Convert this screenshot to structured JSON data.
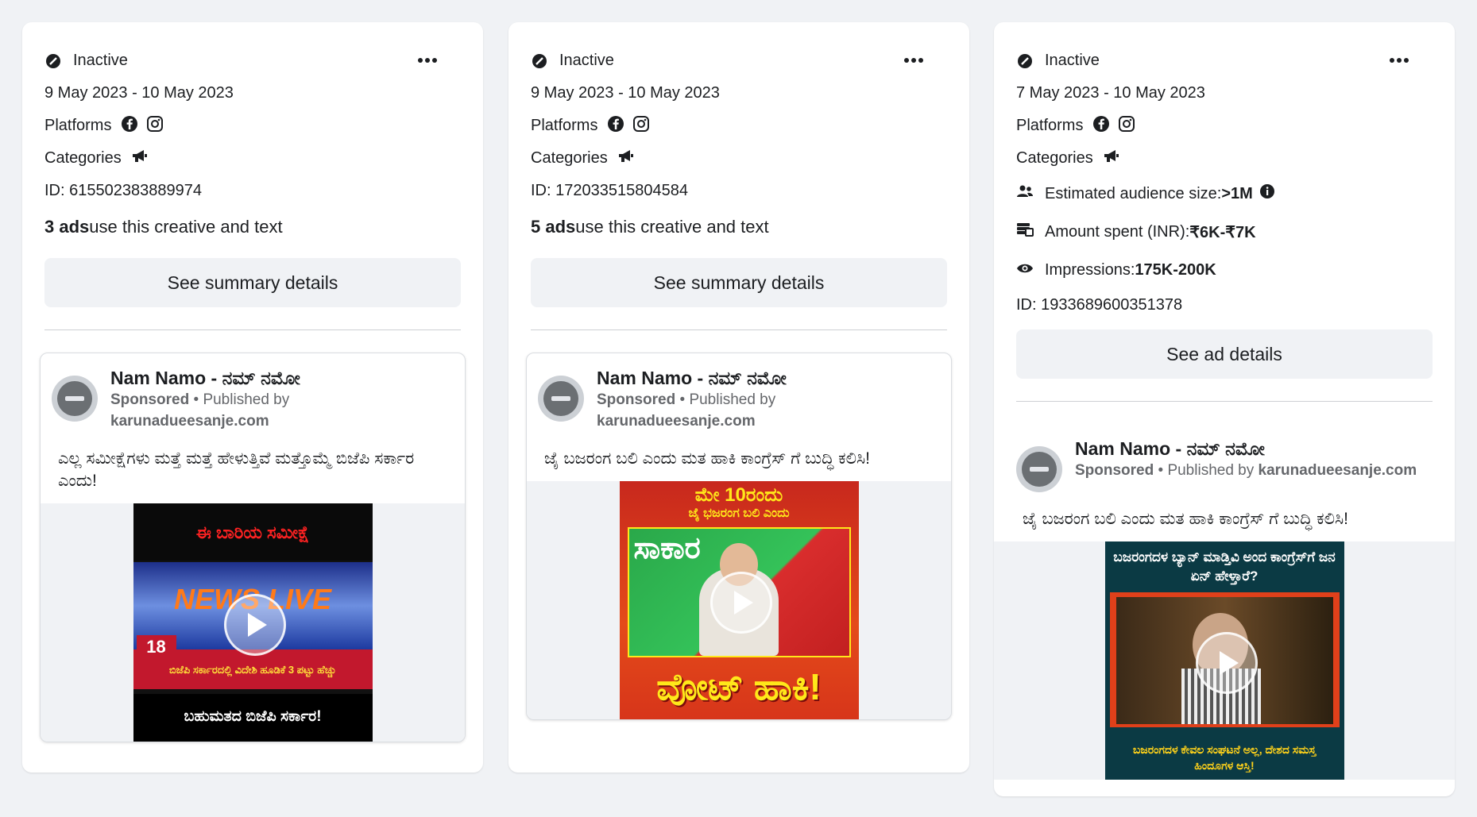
{
  "cards": [
    {
      "status": "Inactive",
      "date_range": "9 May 2023 - 10 May 2023",
      "platforms_label": "Platforms",
      "categories_label": "Categories",
      "id_text": "ID: 615502383889974",
      "ads_count": "3 ads",
      "ads_suffix": " use this creative and text",
      "button_label": "See summary details",
      "preview": {
        "page_name": "Nam Namo - ನಮ್ ನಮೋ",
        "sponsored": "Sponsored",
        "published_by": " • Published by",
        "publisher": "karunadueesanje.com",
        "text": "ಎಲ್ಲ ಸಮೀಕ್ಷೆಗಳು ಮತ್ತೆ ಮತ್ತೆ ಹೇಳುತ್ತಿವೆ ಮತ್ತೊಮ್ಮೆ ಬಿಜೆಪಿ ಸರ್ಕಾರ ಎಂದು!",
        "thumb_top": "ಈ ಬಾರಿಯ ಸಮೀಕ್ಷೆ",
        "thumb_mid": "NEWS LIVE",
        "thumb_bar": "ಬಿಜೆಪಿ ಸರ್ಕಾರದಲ್ಲಿ ವಿದೇಶಿ ಹೂಡಿಕೆ 3 ಪಟ್ಟು ಹೆಚ್ಚು",
        "thumb_bottom": "ಬಹುಮತದ ಬಿಜೆಪಿ ಸರ್ಕಾರ!"
      }
    },
    {
      "status": "Inactive",
      "date_range": "9 May 2023 - 10 May 2023",
      "platforms_label": "Platforms",
      "categories_label": "Categories",
      "id_text": "ID: 172033515804584",
      "ads_count": "5 ads",
      "ads_suffix": " use this creative and text",
      "button_label": "See summary details",
      "preview": {
        "page_name": "Nam Namo - ನಮ್ ನಮೋ",
        "sponsored": "Sponsored",
        "published_by": " • Published by",
        "publisher": "karunadueesanje.com",
        "text": "ಜೈ ಬಜರಂಗ ಬಲಿ ಎಂದು ಮತ ಹಾಕಿ ಕಾಂಗ್ರೆಸ್ ಗೆ ಬುದ್ಧಿ ಕಲಿಸಿ!",
        "thumb_top": "ಮೇ 10ರಂದು",
        "thumb_sub": "ಜೈ ಭಜರಂಗ ಬಲಿ ಎಂದು",
        "thumb_green": "ಸಾಕಾರ",
        "thumb_bottom": "ವೋಟ್ ಹಾಕಿ!"
      }
    },
    {
      "status": "Inactive",
      "date_range": "7 May 2023 - 10 May 2023",
      "platforms_label": "Platforms",
      "categories_label": "Categories",
      "audience_label": "Estimated audience size:",
      "audience_value": ">1M",
      "spent_label": "Amount spent (INR): ",
      "spent_value": "₹6K-₹7K",
      "impressions_label": "Impressions: ",
      "impressions_value": "175K-200K",
      "id_text": "ID: 1933689600351378",
      "button_label": "See ad details",
      "preview": {
        "page_name": "Nam Namo - ನಮ್ ನಮೋ",
        "sponsored": "Sponsored",
        "published_by": " • Published by ",
        "publisher": "karunadueesanje.com",
        "text": "ಜೈ ಬಜರಂಗ ಬಲಿ ಎಂದು ಮತ ಹಾಕಿ ಕಾಂಗ್ರೆಸ್ ಗೆ ಬುದ್ಧಿ ಕಲಿಸಿ!",
        "thumb_top": "ಬಜರಂಗದಳ ಬ್ಯಾನ್ ಮಾಡ್ತಿವಿ ಅಂದ ಕಾಂಗ್ರೆಸ್‌ಗೆ ಜನ ಏನ್ ಹೇಳ್ತಾರೆ?",
        "thumb_bottom": "ಬಜರಂಗದಳ ಕೇವಲ ಸಂಘಟನೆ ಅಲ್ಲ, ದೇಶದ ಸಮಸ್ತ ಹಿಂದೂಗಳ ಆಸ್ತಿ!"
      }
    }
  ],
  "icons": {
    "status": "inactive-status-icon",
    "more": "more-options-icon",
    "facebook": "facebook-icon",
    "instagram": "instagram-icon",
    "category": "megaphone-icon",
    "audience": "people-icon",
    "info": "info-icon",
    "spent": "money-stack-icon",
    "impressions": "eye-icon",
    "play": "play-icon"
  },
  "colors": {
    "accent_red": "#d61f26",
    "facebook_icon": "#1c1e21"
  }
}
